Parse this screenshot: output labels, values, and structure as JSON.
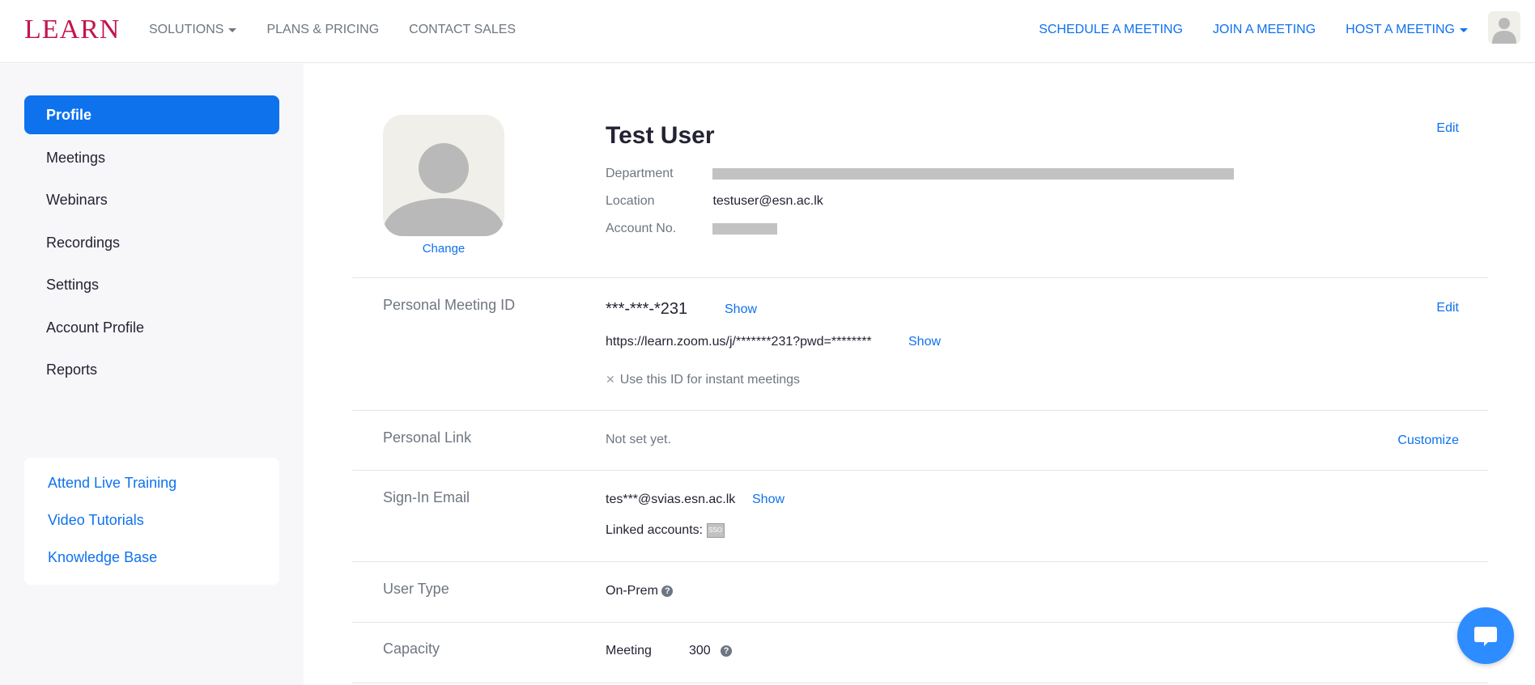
{
  "header": {
    "logo": "LEARN",
    "nav_left": [
      {
        "label": "SOLUTIONS",
        "has_caret": true
      },
      {
        "label": "PLANS & PRICING"
      },
      {
        "label": "CONTACT SALES"
      }
    ],
    "nav_right": [
      {
        "label": "SCHEDULE A MEETING"
      },
      {
        "label": "JOIN A MEETING"
      },
      {
        "label": "HOST A MEETING",
        "has_caret": true
      }
    ]
  },
  "sidebar": {
    "items": [
      {
        "label": "Profile",
        "active": true
      },
      {
        "label": "Meetings"
      },
      {
        "label": "Webinars"
      },
      {
        "label": "Recordings"
      },
      {
        "label": "Settings"
      },
      {
        "label": "Account Profile"
      },
      {
        "label": "Reports"
      }
    ],
    "help_links": [
      {
        "label": "Attend Live Training"
      },
      {
        "label": "Video Tutorials"
      },
      {
        "label": "Knowledge Base"
      }
    ]
  },
  "profile": {
    "change_label": "Change",
    "name": "Test User",
    "edit_label": "Edit",
    "department_label": "Department",
    "location_label": "Location",
    "location_value": "testuser@esn.ac.lk",
    "account_no_label": "Account No."
  },
  "pmi": {
    "label": "Personal Meeting ID",
    "value": "***-***-*231",
    "show_label": "Show",
    "edit_label": "Edit",
    "url": "https://learn.zoom.us/j/*******231?pwd=********",
    "url_show_label": "Show",
    "instant_label": "Use this ID for instant meetings"
  },
  "personal_link": {
    "label": "Personal Link",
    "value": "Not set yet.",
    "customize_label": "Customize"
  },
  "sign_in_email": {
    "label": "Sign-In Email",
    "value": "tes***@svias.esn.ac.lk",
    "show_label": "Show",
    "linked_label": "Linked accounts:",
    "linked_icon_text": "SSO"
  },
  "user_type": {
    "label": "User Type",
    "value": "On-Prem"
  },
  "capacity": {
    "label": "Capacity",
    "meeting_label": "Meeting",
    "meeting_value": "300"
  },
  "colors": {
    "accent": "#0e72ed",
    "brand": "#c4154b",
    "sidebar_bg": "#f7f7fa"
  }
}
